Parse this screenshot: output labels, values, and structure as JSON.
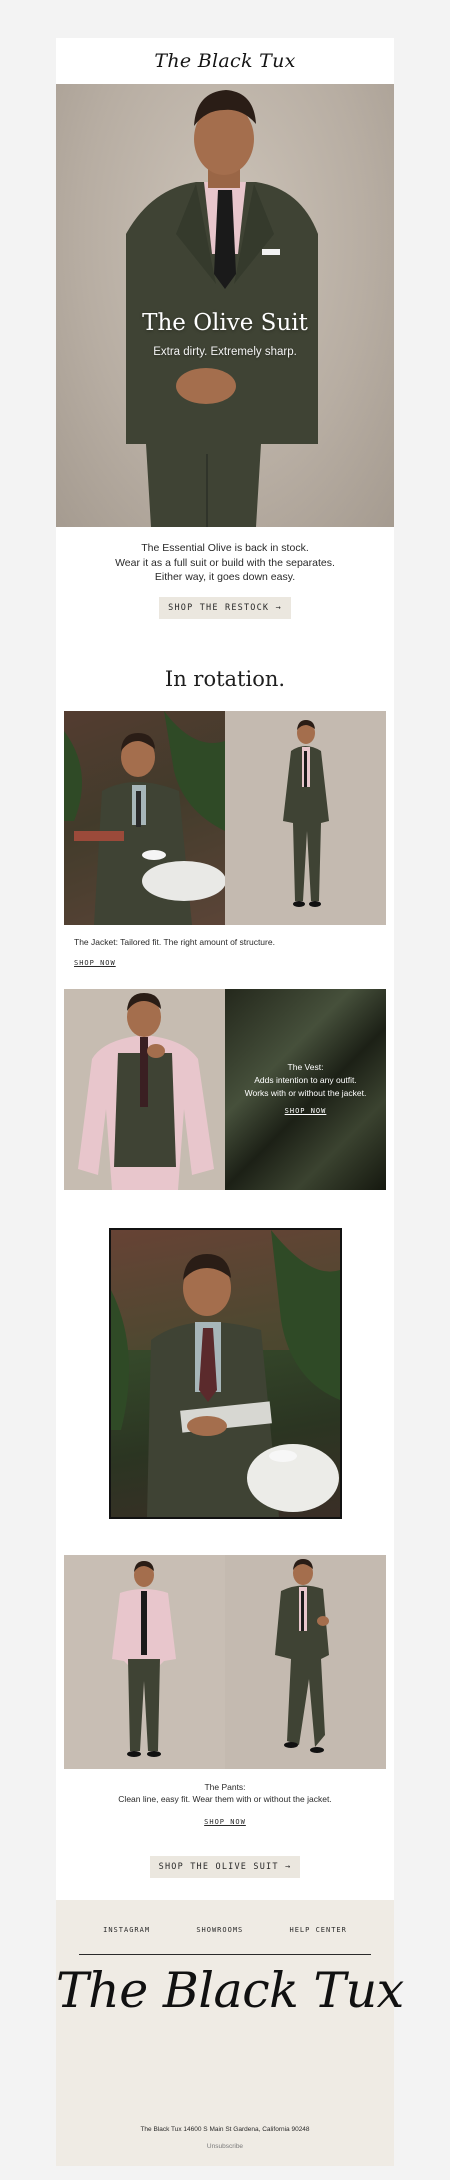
{
  "brand": {
    "name": "The Black Tux"
  },
  "hero": {
    "title": "The Olive Suit",
    "subtitle": "Extra dirty. Extremely sharp.",
    "image_alt": "Model in olive suit with pink shirt and black tie"
  },
  "intro": {
    "lines": [
      "The Essential Olive is back in stock.",
      "Wear it as a full suit or build with the separates.",
      "Either way, it goes down easy."
    ],
    "cta": "SHOP THE RESTOCK →"
  },
  "rotation": {
    "title": "In rotation."
  },
  "jacket": {
    "caption": "The Jacket: Tailored fit. The right amount of structure.",
    "link": "SHOP NOW"
  },
  "vest": {
    "lines": [
      "The Vest:",
      "Adds intention to any outfit.",
      "Works with or without the jacket."
    ],
    "link": "SHOP NOW"
  },
  "pants": {
    "lines": [
      "The Pants:",
      "Clean line, easy fit.  Wear them with or without the jacket."
    ],
    "link": "SHOP NOW"
  },
  "final_cta": "SHOP THE OLIVE SUIT →",
  "footer": {
    "links": [
      "INSTAGRAM",
      "SHOWROOMS",
      "HELP CENTER"
    ],
    "logo": "The Black Tux",
    "address": "The Black Tux 14600 S Main St Gardena, California 90248",
    "unsubscribe": "Unsubscribe"
  },
  "colors": {
    "olive": "#3f4334",
    "pink_shirt": "#e8c6cc",
    "footer_bg": "#efebe4",
    "button_bg": "#ebe7df"
  }
}
